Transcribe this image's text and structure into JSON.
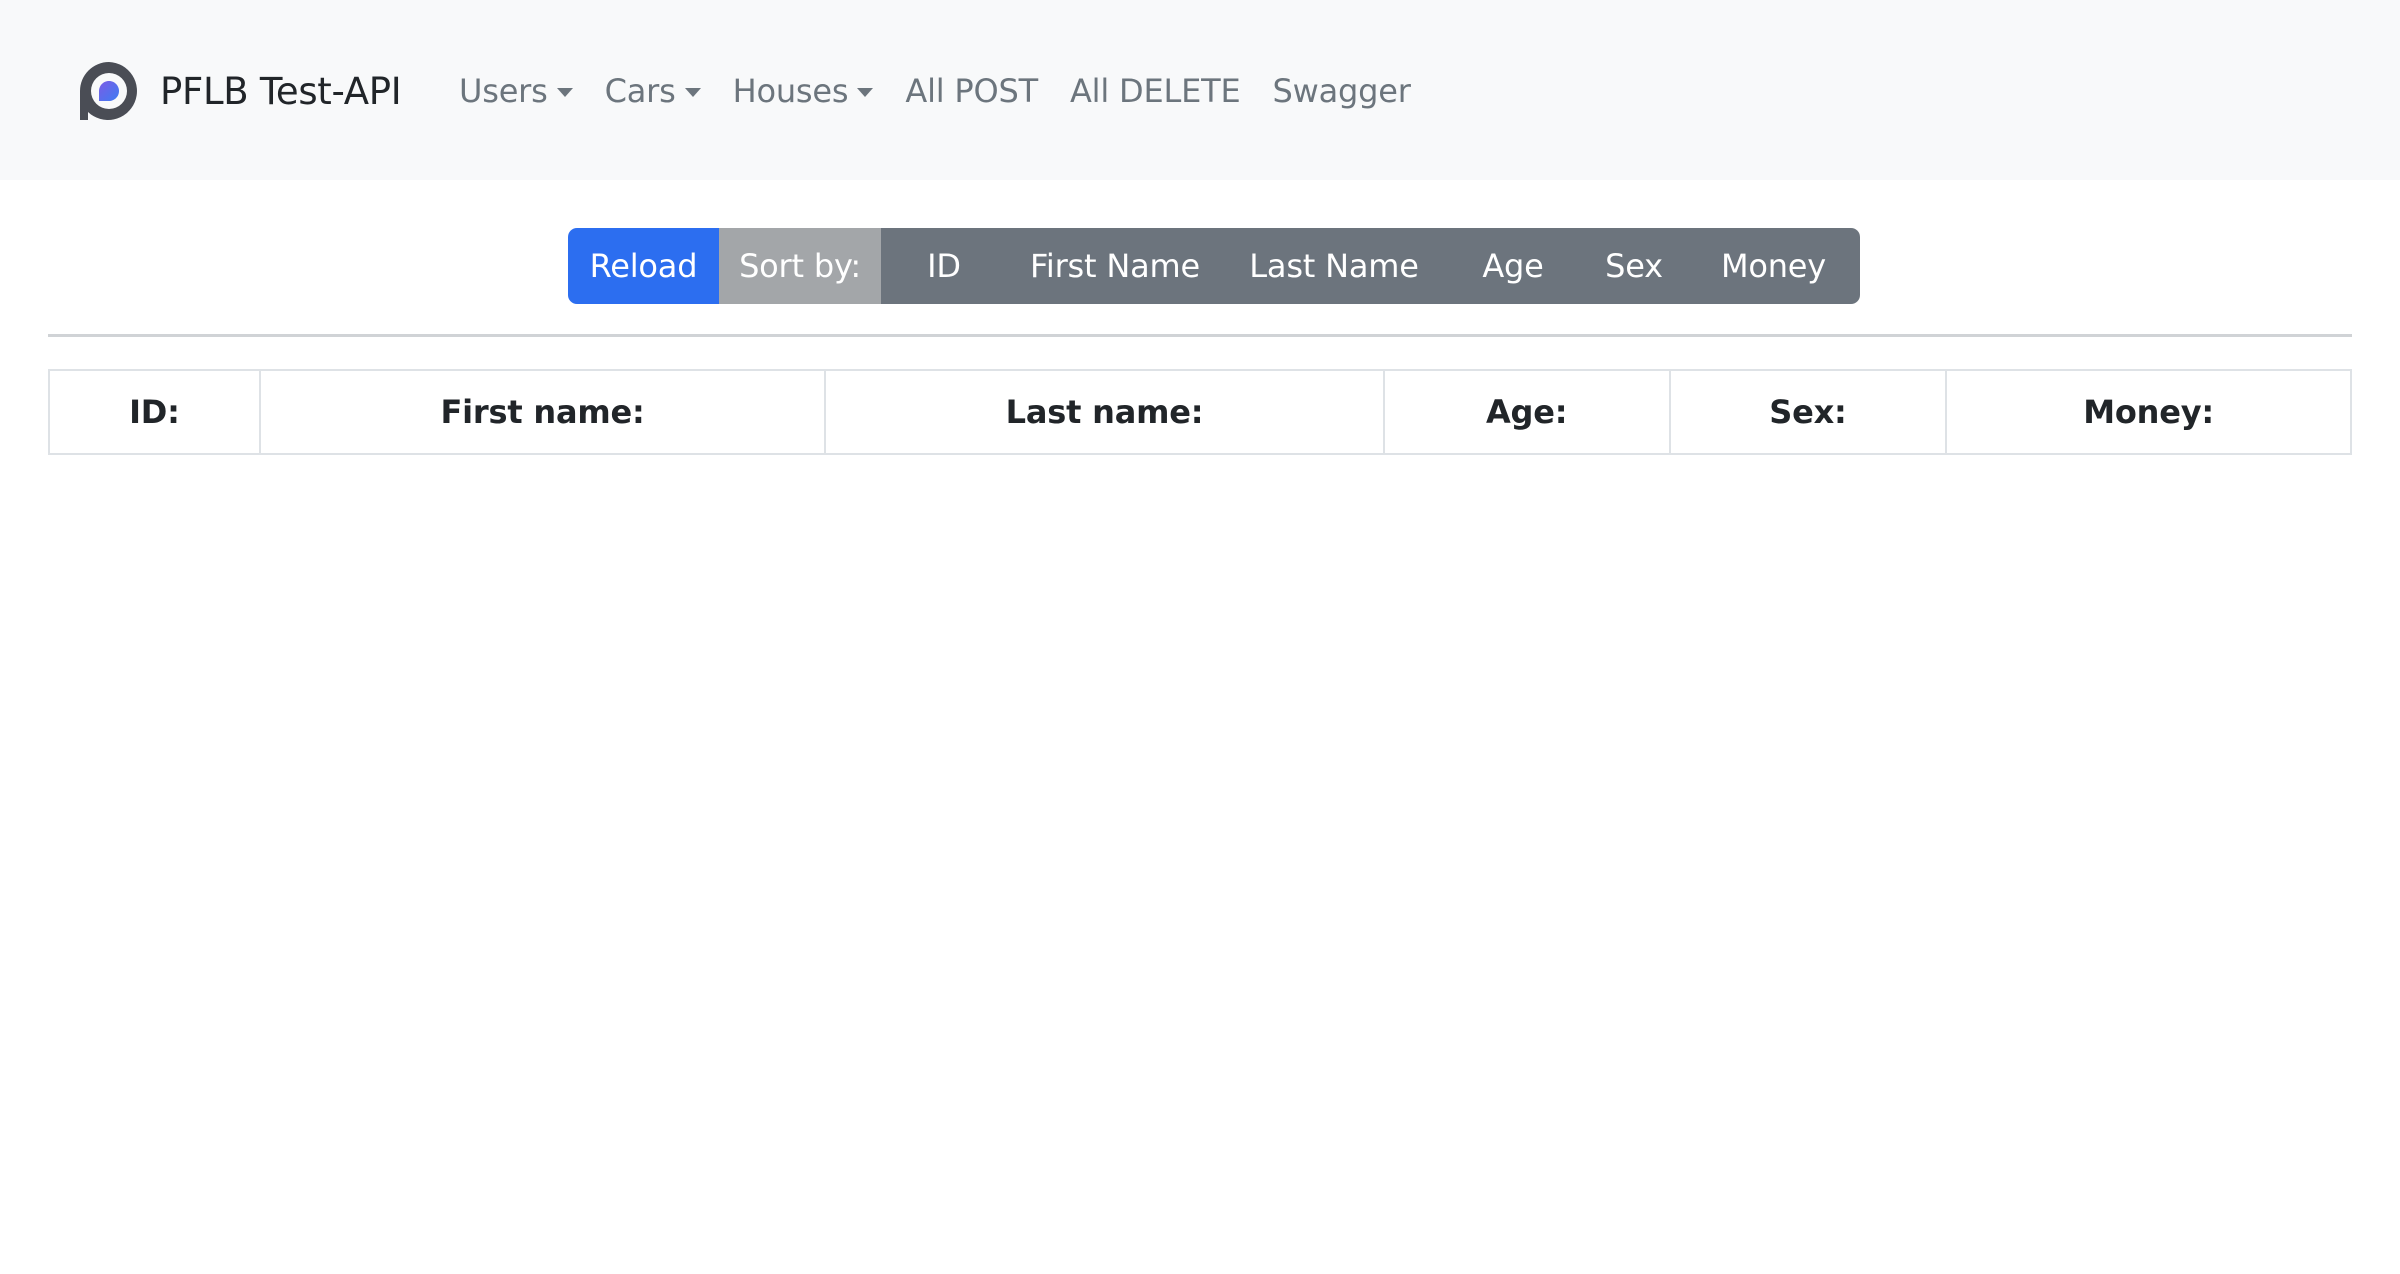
{
  "navbar": {
    "brand_text": "PFLB Test-API",
    "brand_logo_icon": "pflb-logo-icon",
    "items": [
      {
        "label": "Users",
        "dropdown": true
      },
      {
        "label": "Cars",
        "dropdown": true
      },
      {
        "label": "Houses",
        "dropdown": true
      },
      {
        "label": "All POST",
        "dropdown": false
      },
      {
        "label": "All DELETE",
        "dropdown": false
      },
      {
        "label": "Swagger",
        "dropdown": false
      }
    ]
  },
  "toolbar": {
    "reload_label": "Reload",
    "sort_by_label": "Sort by:",
    "sort_options": [
      "ID",
      "First Name",
      "Last Name",
      "Age",
      "Sex",
      "Money"
    ]
  },
  "table": {
    "headers": [
      "ID:",
      "First name:",
      "Last name:",
      "Age:",
      "Sex:",
      "Money:"
    ],
    "rows": []
  },
  "colors": {
    "navbar_bg": "#f8f9fa",
    "primary": "#2c6ef0",
    "secondary": "#6c747d",
    "secondary_light": "#a3a6a9",
    "nav_link": "#6c757d",
    "logo_ring": "#4a4d55",
    "logo_drop_blue": "#3d7cf2",
    "logo_drop_purple": "#7b5ce6"
  }
}
